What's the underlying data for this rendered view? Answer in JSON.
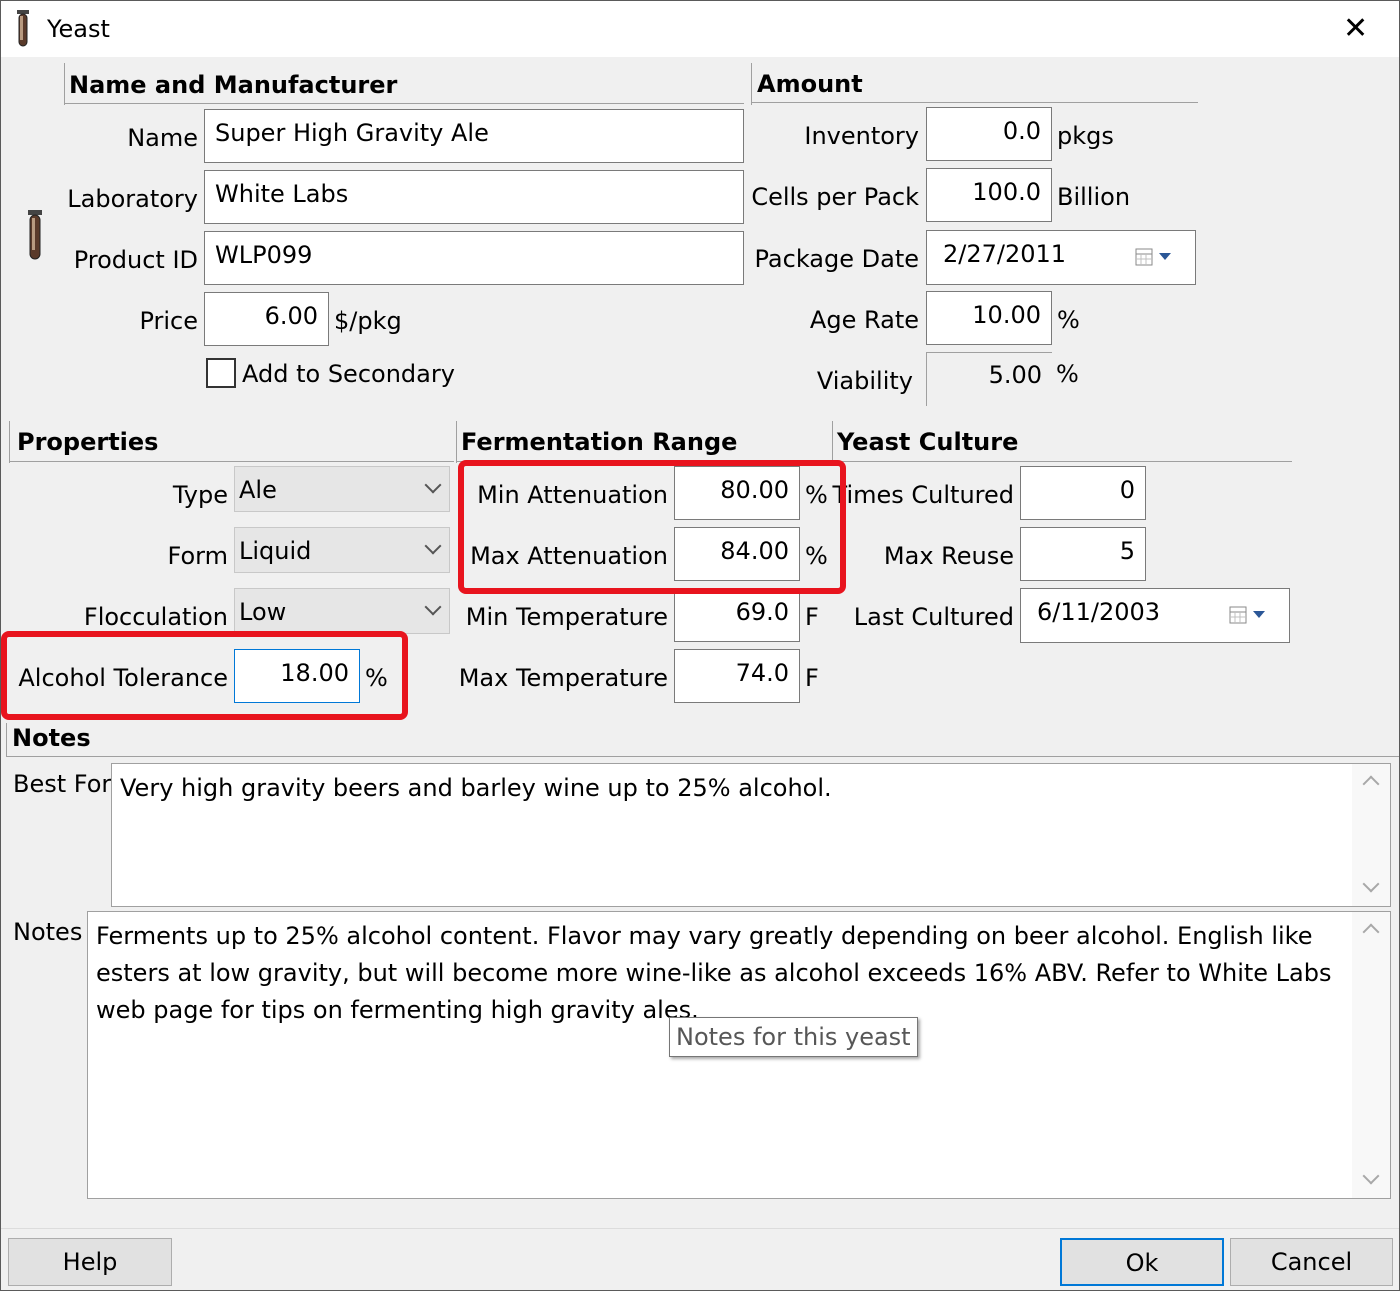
{
  "window": {
    "title": "Yeast",
    "close_label": "✕"
  },
  "name_section": {
    "header": "Name and Manufacturer",
    "name_label": "Name",
    "name_value": "Super High Gravity Ale",
    "lab_label": "Laboratory",
    "lab_value": "White Labs",
    "product_label": "Product ID",
    "product_value": "WLP099",
    "price_label": "Price",
    "price_value": "6.00",
    "price_unit": "$/pkg",
    "secondary_label": "Add to Secondary"
  },
  "amount": {
    "header": "Amount",
    "inventory_label": "Inventory",
    "inventory_value": "0.0",
    "inventory_unit": "pkgs",
    "cells_label": "Cells per Pack",
    "cells_value": "100.0",
    "cells_unit": "Billion",
    "pkgdate_label": "Package Date",
    "pkgdate_value": "2/27/2011",
    "agerate_label": "Age Rate",
    "agerate_value": "10.00",
    "agerate_unit": "%",
    "viability_label": "Viability",
    "viability_value": "5.00",
    "viability_unit": "%"
  },
  "properties": {
    "header": "Properties",
    "type_label": "Type",
    "type_value": "Ale",
    "form_label": "Form",
    "form_value": "Liquid",
    "floc_label": "Flocculation",
    "floc_value": "Low",
    "alcohol_label": "Alcohol Tolerance",
    "alcohol_value": "18.00",
    "alcohol_unit": "%"
  },
  "fermentation": {
    "header": "Fermentation Range",
    "min_att_label": "Min Attenuation",
    "min_att_value": "80.00",
    "min_att_unit": "%",
    "max_att_label": "Max Attenuation",
    "max_att_value": "84.00",
    "max_att_unit": "%",
    "min_temp_label": "Min Temperature",
    "min_temp_value": "69.0",
    "min_temp_unit": "F",
    "max_temp_label": "Max Temperature",
    "max_temp_value": "74.0",
    "max_temp_unit": "F"
  },
  "culture": {
    "header": "Yeast Culture",
    "times_label": "Times Cultured",
    "times_value": "0",
    "reuse_label": "Max Reuse",
    "reuse_value": "5",
    "last_label": "Last Cultured",
    "last_value": "6/11/2003"
  },
  "notes": {
    "header": "Notes",
    "bestfor_label": "Best For",
    "bestfor_value": "Very high gravity beers and barley wine up to 25% alcohol.",
    "notes_label": "Notes",
    "notes_line1": "Ferments up to 25% alcohol content.  Flavor may vary greatly depending on beer alcohol.  English like",
    "notes_line2": "esters at low gravity, but will become more wine-like as alcohol exceeds 16% ABV.  Refer to White Labs",
    "notes_line3": "web page for tips on fermenting high gravity ales.",
    "tooltip": "Notes for this yeast"
  },
  "buttons": {
    "help": "Help",
    "ok": "Ok",
    "cancel": "Cancel"
  },
  "colors": {
    "highlight": "#e8141e",
    "focus_border": "#0078d7"
  }
}
